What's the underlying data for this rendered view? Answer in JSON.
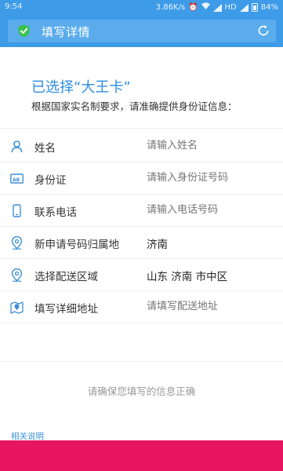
{
  "status_bar": {
    "time": "9:54",
    "speed": "3.86K/s",
    "network": "HD",
    "battery": "84%"
  },
  "header": {
    "title": "填写详情",
    "shield_icon": "verified-shield-icon",
    "refresh_icon": "refresh-icon",
    "bg_color": "#3d9be8"
  },
  "selection": {
    "title": "已选择“大王卡”",
    "subtitle": "根据国家实名制要求，请准确提供身份证信息："
  },
  "form": {
    "name": {
      "label": "姓名",
      "placeholder": "请输入姓名"
    },
    "id_card": {
      "label": "身份证",
      "placeholder": "请输入身份证号码"
    },
    "phone": {
      "label": "联系电话",
      "placeholder": "请输入电话号码"
    },
    "number_location": {
      "label": "新申请号码归属地",
      "value": "济南"
    },
    "delivery_area": {
      "label": "选择配送区域",
      "value": "山东 济南 市中区"
    },
    "address": {
      "label": "填写详细地址",
      "placeholder": "请填写配送地址"
    }
  },
  "hint": "请确保您填写的信息正确",
  "related_link": "相关说明",
  "accent_color": "#e8155f"
}
